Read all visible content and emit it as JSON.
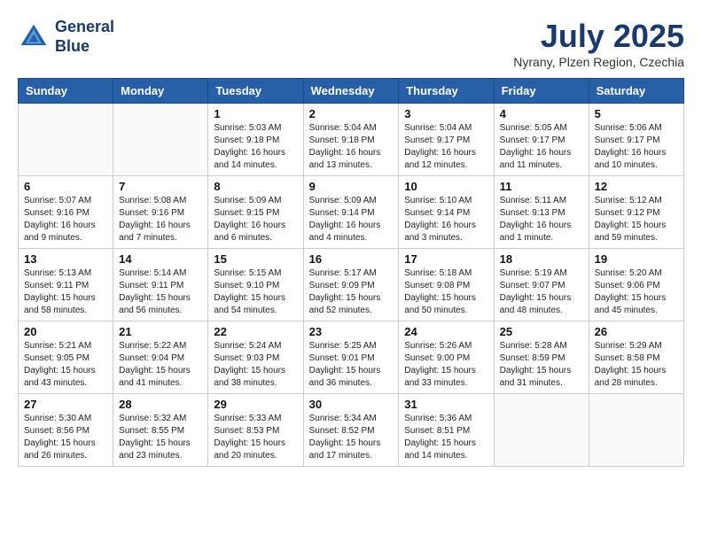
{
  "logo": {
    "line1": "General",
    "line2": "Blue"
  },
  "title": "July 2025",
  "location": "Nyrany, Plzen Region, Czechia",
  "days_of_week": [
    "Sunday",
    "Monday",
    "Tuesday",
    "Wednesday",
    "Thursday",
    "Friday",
    "Saturday"
  ],
  "weeks": [
    [
      {
        "day": "",
        "info": ""
      },
      {
        "day": "",
        "info": ""
      },
      {
        "day": "1",
        "info": "Sunrise: 5:03 AM\nSunset: 9:18 PM\nDaylight: 16 hours\nand 14 minutes."
      },
      {
        "day": "2",
        "info": "Sunrise: 5:04 AM\nSunset: 9:18 PM\nDaylight: 16 hours\nand 13 minutes."
      },
      {
        "day": "3",
        "info": "Sunrise: 5:04 AM\nSunset: 9:17 PM\nDaylight: 16 hours\nand 12 minutes."
      },
      {
        "day": "4",
        "info": "Sunrise: 5:05 AM\nSunset: 9:17 PM\nDaylight: 16 hours\nand 11 minutes."
      },
      {
        "day": "5",
        "info": "Sunrise: 5:06 AM\nSunset: 9:17 PM\nDaylight: 16 hours\nand 10 minutes."
      }
    ],
    [
      {
        "day": "6",
        "info": "Sunrise: 5:07 AM\nSunset: 9:16 PM\nDaylight: 16 hours\nand 9 minutes."
      },
      {
        "day": "7",
        "info": "Sunrise: 5:08 AM\nSunset: 9:16 PM\nDaylight: 16 hours\nand 7 minutes."
      },
      {
        "day": "8",
        "info": "Sunrise: 5:09 AM\nSunset: 9:15 PM\nDaylight: 16 hours\nand 6 minutes."
      },
      {
        "day": "9",
        "info": "Sunrise: 5:09 AM\nSunset: 9:14 PM\nDaylight: 16 hours\nand 4 minutes."
      },
      {
        "day": "10",
        "info": "Sunrise: 5:10 AM\nSunset: 9:14 PM\nDaylight: 16 hours\nand 3 minutes."
      },
      {
        "day": "11",
        "info": "Sunrise: 5:11 AM\nSunset: 9:13 PM\nDaylight: 16 hours\nand 1 minute."
      },
      {
        "day": "12",
        "info": "Sunrise: 5:12 AM\nSunset: 9:12 PM\nDaylight: 15 hours\nand 59 minutes."
      }
    ],
    [
      {
        "day": "13",
        "info": "Sunrise: 5:13 AM\nSunset: 9:11 PM\nDaylight: 15 hours\nand 58 minutes."
      },
      {
        "day": "14",
        "info": "Sunrise: 5:14 AM\nSunset: 9:11 PM\nDaylight: 15 hours\nand 56 minutes."
      },
      {
        "day": "15",
        "info": "Sunrise: 5:15 AM\nSunset: 9:10 PM\nDaylight: 15 hours\nand 54 minutes."
      },
      {
        "day": "16",
        "info": "Sunrise: 5:17 AM\nSunset: 9:09 PM\nDaylight: 15 hours\nand 52 minutes."
      },
      {
        "day": "17",
        "info": "Sunrise: 5:18 AM\nSunset: 9:08 PM\nDaylight: 15 hours\nand 50 minutes."
      },
      {
        "day": "18",
        "info": "Sunrise: 5:19 AM\nSunset: 9:07 PM\nDaylight: 15 hours\nand 48 minutes."
      },
      {
        "day": "19",
        "info": "Sunrise: 5:20 AM\nSunset: 9:06 PM\nDaylight: 15 hours\nand 45 minutes."
      }
    ],
    [
      {
        "day": "20",
        "info": "Sunrise: 5:21 AM\nSunset: 9:05 PM\nDaylight: 15 hours\nand 43 minutes."
      },
      {
        "day": "21",
        "info": "Sunrise: 5:22 AM\nSunset: 9:04 PM\nDaylight: 15 hours\nand 41 minutes."
      },
      {
        "day": "22",
        "info": "Sunrise: 5:24 AM\nSunset: 9:03 PM\nDaylight: 15 hours\nand 38 minutes."
      },
      {
        "day": "23",
        "info": "Sunrise: 5:25 AM\nSunset: 9:01 PM\nDaylight: 15 hours\nand 36 minutes."
      },
      {
        "day": "24",
        "info": "Sunrise: 5:26 AM\nSunset: 9:00 PM\nDaylight: 15 hours\nand 33 minutes."
      },
      {
        "day": "25",
        "info": "Sunrise: 5:28 AM\nSunset: 8:59 PM\nDaylight: 15 hours\nand 31 minutes."
      },
      {
        "day": "26",
        "info": "Sunrise: 5:29 AM\nSunset: 8:58 PM\nDaylight: 15 hours\nand 28 minutes."
      }
    ],
    [
      {
        "day": "27",
        "info": "Sunrise: 5:30 AM\nSunset: 8:56 PM\nDaylight: 15 hours\nand 26 minutes."
      },
      {
        "day": "28",
        "info": "Sunrise: 5:32 AM\nSunset: 8:55 PM\nDaylight: 15 hours\nand 23 minutes."
      },
      {
        "day": "29",
        "info": "Sunrise: 5:33 AM\nSunset: 8:53 PM\nDaylight: 15 hours\nand 20 minutes."
      },
      {
        "day": "30",
        "info": "Sunrise: 5:34 AM\nSunset: 8:52 PM\nDaylight: 15 hours\nand 17 minutes."
      },
      {
        "day": "31",
        "info": "Sunrise: 5:36 AM\nSunset: 8:51 PM\nDaylight: 15 hours\nand 14 minutes."
      },
      {
        "day": "",
        "info": ""
      },
      {
        "day": "",
        "info": ""
      }
    ]
  ]
}
